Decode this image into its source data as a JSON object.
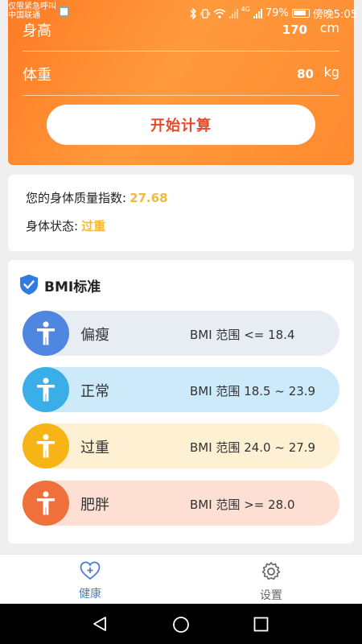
{
  "status_bar": {
    "carrier_line1": "仅限紧急呼叫",
    "carrier_line2": "中国联通",
    "signal_tag": "4G",
    "battery": "79%",
    "time": "傍晚5:05"
  },
  "form": {
    "height": {
      "label": "身高",
      "value": "170",
      "unit": "cm"
    },
    "weight": {
      "label": "体重",
      "value": "80",
      "unit": "kg"
    },
    "start_button": "开始计算"
  },
  "result": {
    "bmi_label": "您的身体质量指数:",
    "bmi_value": "27.68",
    "status_label": "身体状态:",
    "status_value": "过重"
  },
  "standard": {
    "title": "BMI标准",
    "items": [
      {
        "name": "偏瘦",
        "range": "BMI 范围 <= 18.4",
        "bg": "#e8edf4",
        "circle": "#4f86df"
      },
      {
        "name": "正常",
        "range": "BMI 范围 18.5 ~ 23.9",
        "bg": "#cdeafb",
        "circle": "#3aaee8"
      },
      {
        "name": "过重",
        "range": "BMI 范围 24.0 ~ 27.9",
        "bg": "#fdf0d3",
        "circle": "#f6b417"
      },
      {
        "name": "肥胖",
        "range": "BMI 范围 >= 28.0",
        "bg": "#fde0d3",
        "circle": "#f0703c"
      }
    ]
  },
  "nav": {
    "health": "健康",
    "settings": "设置"
  },
  "colors": {
    "accent_blue": "#4a7fd6",
    "orange": "#ff7a25",
    "result_highlight": "#f2b83c"
  }
}
